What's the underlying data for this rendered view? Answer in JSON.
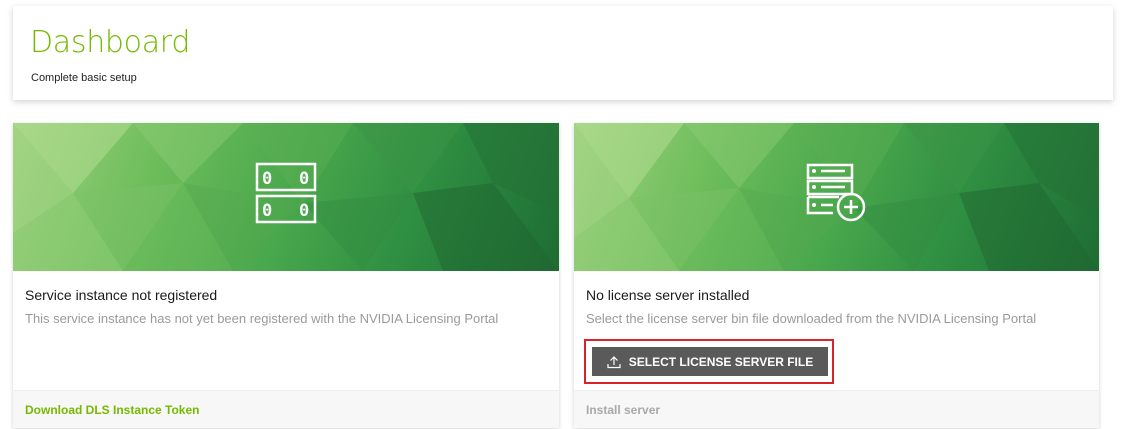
{
  "header": {
    "title": "Dashboard",
    "subtitle": "Complete basic setup"
  },
  "cards": [
    {
      "title": "Service instance not registered",
      "description": "This service instance has not yet been registered with the NVIDIA Licensing Portal",
      "icon": "server-rack-icon",
      "footer_link": "Download DLS Instance Token"
    },
    {
      "title": "No license server installed",
      "description": "Select the license server bin file downloaded from the NVIDIA Licensing Portal",
      "icon": "server-add-icon",
      "button_label": "SELECT LICENSE SERVER FILE",
      "button_icon": "upload-icon",
      "footer_link": "Install server"
    }
  ],
  "colors": {
    "accent": "#76b900",
    "button_bg": "#5a5a5a",
    "highlight": "#d9232a",
    "muted": "#9a9a9a"
  }
}
